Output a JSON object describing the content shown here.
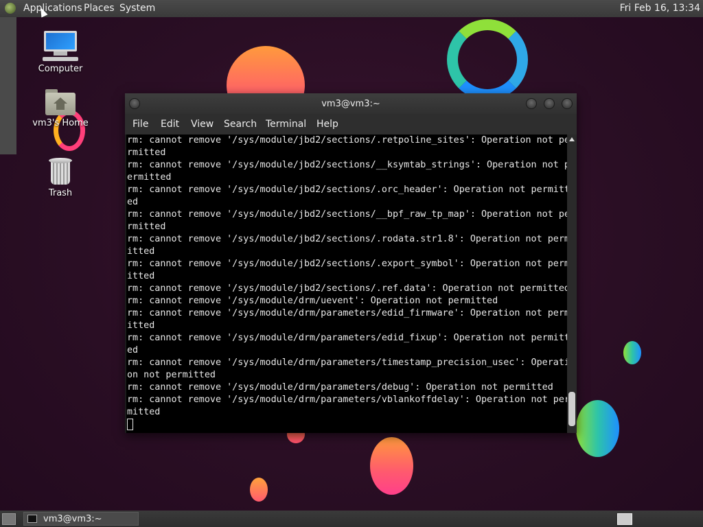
{
  "top_panel": {
    "menus": [
      "Applications",
      "Places",
      "System"
    ],
    "clock": "Fri Feb 16, 13:34"
  },
  "desktop_icons": [
    {
      "label": "Computer",
      "icon": "computer-icon"
    },
    {
      "label": "vm3's Home",
      "icon": "home-folder-icon"
    },
    {
      "label": "Trash",
      "icon": "trash-icon"
    }
  ],
  "terminal": {
    "title": "vm3@vm3:~",
    "menus": [
      "File",
      "Edit",
      "View",
      "Search",
      "Terminal",
      "Help"
    ],
    "output": "rm: cannot remove '/sys/module/jbd2/sections/.retpoline_sites': Operation not pe\nrmitted\nrm: cannot remove '/sys/module/jbd2/sections/__ksymtab_strings': Operation not p\nermitted\nrm: cannot remove '/sys/module/jbd2/sections/.orc_header': Operation not permitt\ned\nrm: cannot remove '/sys/module/jbd2/sections/__bpf_raw_tp_map': Operation not pe\nrmitted\nrm: cannot remove '/sys/module/jbd2/sections/.rodata.str1.8': Operation not perm\nitted\nrm: cannot remove '/sys/module/jbd2/sections/.export_symbol': Operation not perm\nitted\nrm: cannot remove '/sys/module/jbd2/sections/.ref.data': Operation not permitted\nrm: cannot remove '/sys/module/drm/uevent': Operation not permitted\nrm: cannot remove '/sys/module/drm/parameters/edid_firmware': Operation not perm\nitted\nrm: cannot remove '/sys/module/drm/parameters/edid_fixup': Operation not permitt\ned\nrm: cannot remove '/sys/module/drm/parameters/timestamp_precision_usec': Operati\non not permitted\nrm: cannot remove '/sys/module/drm/parameters/debug': Operation not permitted\nrm: cannot remove '/sys/module/drm/parameters/vblankoffdelay': Operation not per\nmitted"
  },
  "taskbar": {
    "items": [
      {
        "label": "vm3@vm3:~",
        "icon": "terminal-icon"
      }
    ]
  }
}
